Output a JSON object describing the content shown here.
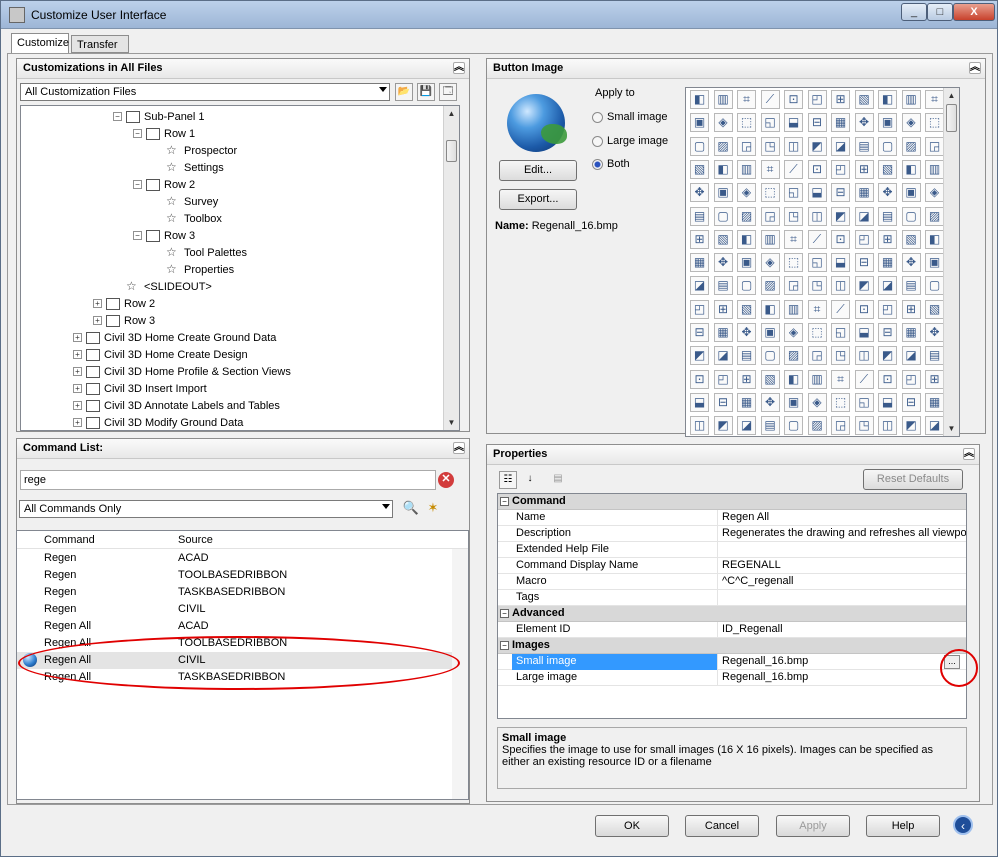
{
  "window": {
    "title": "Customize User Interface",
    "minimize": "_",
    "maximize": "□",
    "close": "X"
  },
  "tabs": [
    "Customize",
    "Transfer"
  ],
  "customizations": {
    "header": "Customizations in All Files",
    "filter": "All Customization Files",
    "tree": [
      {
        "label": "Sub-Panel 1",
        "depth": 5,
        "expander": "−",
        "icon": "panel"
      },
      {
        "label": "Row 1",
        "depth": 6,
        "expander": "−",
        "icon": "panel"
      },
      {
        "label": "Prospector",
        "depth": 7,
        "icon": "star"
      },
      {
        "label": "Settings",
        "depth": 7,
        "icon": "star"
      },
      {
        "label": "Row 2",
        "depth": 6,
        "expander": "−",
        "icon": "panel"
      },
      {
        "label": "Survey",
        "depth": 7,
        "icon": "star"
      },
      {
        "label": "Toolbox",
        "depth": 7,
        "icon": "star"
      },
      {
        "label": "Row 3",
        "depth": 6,
        "expander": "−",
        "icon": "panel"
      },
      {
        "label": "Tool Palettes",
        "depth": 7,
        "icon": "star"
      },
      {
        "label": "Properties",
        "depth": 7,
        "icon": "star"
      },
      {
        "label": "<SLIDEOUT>",
        "depth": 5,
        "icon": "star"
      },
      {
        "label": "Row 2",
        "depth": 4,
        "expander": "+",
        "icon": "panel"
      },
      {
        "label": "Row 3",
        "depth": 4,
        "expander": "+",
        "icon": "panel"
      },
      {
        "label": "Civil 3D Home Create Ground Data",
        "depth": 3,
        "expander": "+",
        "icon": "ribbon"
      },
      {
        "label": "Civil 3D Home Create Design",
        "depth": 3,
        "expander": "+",
        "icon": "ribbon"
      },
      {
        "label": "Civil 3D Home Profile & Section Views",
        "depth": 3,
        "expander": "+",
        "icon": "ribbon"
      },
      {
        "label": "Civil 3D Insert Import",
        "depth": 3,
        "expander": "+",
        "icon": "ribbon"
      },
      {
        "label": "Civil 3D Annotate Labels and Tables",
        "depth": 3,
        "expander": "+",
        "icon": "ribbon"
      },
      {
        "label": "Civil 3D Modify Ground Data",
        "depth": 3,
        "expander": "+",
        "icon": "ribbon"
      }
    ]
  },
  "command_list": {
    "header": "Command List:",
    "search_value": "rege",
    "filter": "All Commands Only",
    "columns": [
      "Command",
      "Source"
    ],
    "rows": [
      {
        "command": "Regen",
        "source": "ACAD"
      },
      {
        "command": "Regen",
        "source": "TOOLBASEDRIBBON"
      },
      {
        "command": "Regen",
        "source": "TASKBASEDRIBBON"
      },
      {
        "command": "Regen",
        "source": "CIVIL"
      },
      {
        "command": "Regen All",
        "source": "ACAD"
      },
      {
        "command": "Regen All",
        "source": "TOOLBASEDRIBBON"
      },
      {
        "command": "Regen All",
        "source": "CIVIL",
        "selected": true
      },
      {
        "command": "Regen All",
        "source": "TASKBASEDRIBBON"
      }
    ]
  },
  "button_image": {
    "header": "Button Image",
    "apply_to": "Apply to",
    "options": [
      "Small image",
      "Large image",
      "Both"
    ],
    "selected_option": "Both",
    "edit": "Edit...",
    "export": "Export...",
    "name_label": "Name:",
    "name_value": "Regenall_16.bmp"
  },
  "properties": {
    "header": "Properties",
    "reset": "Reset Defaults",
    "categories": [
      {
        "name": "Command",
        "rows": [
          {
            "key": "Name",
            "value": "Regen All"
          },
          {
            "key": "Description",
            "value": "Regenerates the drawing and refreshes all viewports"
          },
          {
            "key": "Extended Help File",
            "value": ""
          },
          {
            "key": "Command Display Name",
            "value": "REGENALL"
          },
          {
            "key": "Macro",
            "value": "^C^C_regenall"
          },
          {
            "key": "Tags",
            "value": ""
          }
        ]
      },
      {
        "name": "Advanced",
        "rows": [
          {
            "key": "Element ID",
            "value": "ID_Regenall"
          }
        ]
      },
      {
        "name": "Images",
        "rows": [
          {
            "key": "Small image",
            "value": "Regenall_16.bmp",
            "selected": true
          },
          {
            "key": "Large image",
            "value": "Regenall_16.bmp"
          }
        ]
      }
    ],
    "browse": "...",
    "desc_title": "Small image",
    "desc_text": "Specifies the image to use for small images (16 X 16 pixels). Images can be specified as either an existing resource ID or a filename"
  },
  "footer": {
    "ok": "OK",
    "cancel": "Cancel",
    "apply": "Apply",
    "help": "Help"
  },
  "colors": {
    "selection": "#3399ff",
    "annotation": "#e00000"
  }
}
